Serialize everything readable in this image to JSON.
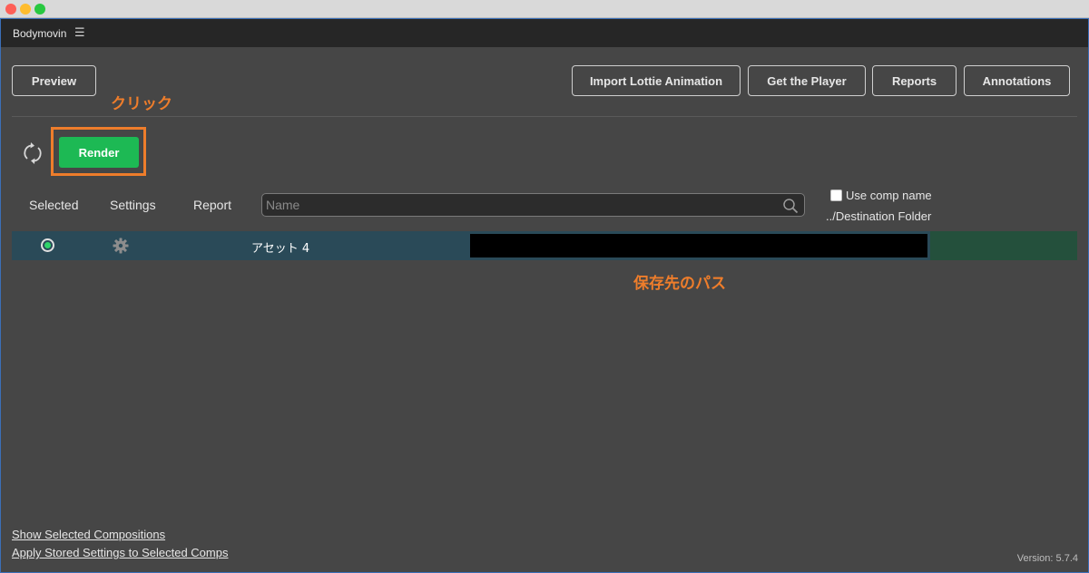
{
  "panel": {
    "title": "Bodymovin",
    "menu_icon": "hamburger-icon"
  },
  "toolbar": {
    "preview": "Preview",
    "import_lottie": "Import Lottie Animation",
    "get_player": "Get the Player",
    "reports": "Reports",
    "annotations": "Annotations"
  },
  "annotations": {
    "click": "クリック",
    "save_path": "保存先のパス"
  },
  "render": {
    "label": "Render",
    "refresh_icon": "refresh-icon"
  },
  "columns": {
    "selected": "Selected",
    "settings": "Settings",
    "report": "Report"
  },
  "search": {
    "placeholder": "Name",
    "value": ""
  },
  "options": {
    "use_comp_name": "Use comp name",
    "use_comp_name_checked": false,
    "destination_folder": "../Destination Folder"
  },
  "compositions": [
    {
      "name": "アセット 4",
      "selected": true,
      "destination": ""
    }
  ],
  "footer": {
    "show_selected": "Show Selected Compositions",
    "apply_stored": "Apply Stored Settings to Selected Comps",
    "version": "Version: 5.7.4"
  },
  "colors": {
    "accent_green": "#1db954",
    "annotation_orange": "#ee7d2b",
    "window_border": "#3b6fb8"
  }
}
